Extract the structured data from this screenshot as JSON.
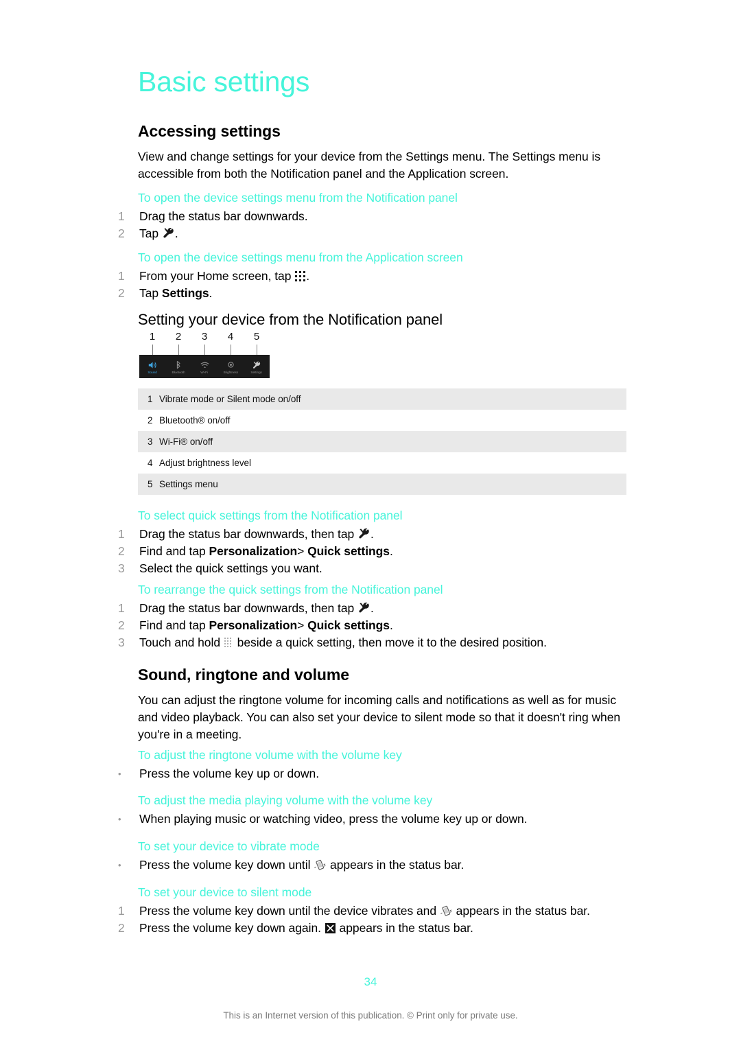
{
  "page": {
    "chapter_title": "Basic settings",
    "page_number": "34",
    "footer_note": "This is an Internet version of this publication. © Print only for private use."
  },
  "accessing_settings": {
    "heading": "Accessing settings",
    "intro": "View and change settings for your device from the Settings menu. The Settings menu is accessible from both the Notification panel and the Application screen.",
    "task_notification": {
      "title": "To open the device settings menu from the Notification panel",
      "steps": [
        {
          "num": "1",
          "text_before": "Drag the status bar downwards.",
          "icon": "",
          "text_after": ""
        },
        {
          "num": "2",
          "text_before": "Tap ",
          "icon": "tools-icon",
          "text_after": "."
        }
      ]
    },
    "task_application": {
      "title": "To open the device settings menu from the Application screen",
      "steps": [
        {
          "num": "1",
          "text_before": "From your Home screen, tap ",
          "icon": "app-grid-icon",
          "text_after": "."
        },
        {
          "num": "2",
          "text_before": "Tap ",
          "bold": "Settings",
          "icon": "",
          "text_after": "."
        }
      ]
    }
  },
  "notification_panel_section": {
    "heading": "Setting your device from the Notification panel",
    "figure": {
      "callouts": [
        "1",
        "2",
        "3",
        "4",
        "5"
      ],
      "panel_items": [
        {
          "label": "Sound",
          "icon": "speaker-icon",
          "state": "active"
        },
        {
          "label": "Bluetooth",
          "icon": "bluetooth-icon",
          "state": "inactive"
        },
        {
          "label": "Wi-Fi",
          "icon": "wifi-icon",
          "state": "inactive"
        },
        {
          "label": "Brightness",
          "icon": "brightness-icon",
          "state": "inactive"
        },
        {
          "label": "Settings",
          "icon": "tools-icon",
          "state": "inactive"
        }
      ]
    },
    "legend": [
      {
        "num": "1",
        "text": "Vibrate mode or Silent mode on/off"
      },
      {
        "num": "2",
        "text": "Bluetooth® on/off"
      },
      {
        "num": "3",
        "text": "Wi-Fi® on/off"
      },
      {
        "num": "4",
        "text": "Adjust brightness level"
      },
      {
        "num": "5",
        "text": "Settings menu"
      }
    ],
    "task_select": {
      "title": "To select quick settings from the Notification panel",
      "steps": [
        {
          "num": "1",
          "text_before": "Drag the status bar downwards, then tap ",
          "icon": "tools-icon",
          "text_after": "."
        },
        {
          "num": "2",
          "text_before": "Find and tap ",
          "bold1": "Personalization",
          "mid": ">",
          "bold2": " Quick settings",
          "text_after": "."
        },
        {
          "num": "3",
          "text_before": "Select the quick settings you want.",
          "icon": "",
          "text_after": ""
        }
      ]
    },
    "task_rearrange": {
      "title": "To rearrange the quick settings from the Notification panel",
      "steps": [
        {
          "num": "1",
          "text_before": "Drag the status bar downwards, then tap ",
          "icon": "tools-icon",
          "text_after": "."
        },
        {
          "num": "2",
          "text_before": "Find and tap ",
          "bold1": "Personalization",
          "mid": ">",
          "bold2": " Quick settings",
          "text_after": "."
        },
        {
          "num": "3",
          "text_before": "Touch and hold ",
          "icon": "drag-handle-icon",
          "text_after": " beside a quick setting, then move it to the desired position."
        }
      ]
    }
  },
  "sound_section": {
    "heading": "Sound, ringtone and volume",
    "intro": "You can adjust the ringtone volume for incoming calls and notifications as well as for music and video playback. You can also set your device to silent mode so that it doesn't ring when you're in a meeting.",
    "task_ringtone": {
      "title": "To adjust the ringtone volume with the volume key",
      "steps": [
        {
          "bullet": "•",
          "text_before": "Press the volume key up or down.",
          "icon": "",
          "text_after": ""
        }
      ]
    },
    "task_media": {
      "title": "To adjust the media playing volume with the volume key",
      "steps": [
        {
          "bullet": "•",
          "text_before": "When playing music or watching video, press the volume key up or down.",
          "icon": "",
          "text_after": ""
        }
      ]
    },
    "task_vibrate": {
      "title": "To set your device to vibrate mode",
      "steps": [
        {
          "bullet": "•",
          "text_before": "Press the volume key down until ",
          "icon": "vibrate-icon",
          "text_after": " appears in the status bar."
        }
      ]
    },
    "task_silent": {
      "title": "To set your device to silent mode",
      "steps": [
        {
          "num": "1",
          "text_before": "Press the volume key down until the device vibrates and ",
          "icon": "vibrate-icon",
          "text_after": " appears in the status bar."
        },
        {
          "num": "2",
          "text_before": "Press the volume key down again. ",
          "icon": "silent-icon",
          "text_after": " appears in the status bar."
        }
      ]
    }
  },
  "colors": {
    "accent_cyan": "#46f4da",
    "list_number_grey": "#9a9a9a",
    "table_shade": "#e9e9e9",
    "panel_background": "#1b1b1b",
    "panel_active_blue": "#3ea4e0"
  }
}
